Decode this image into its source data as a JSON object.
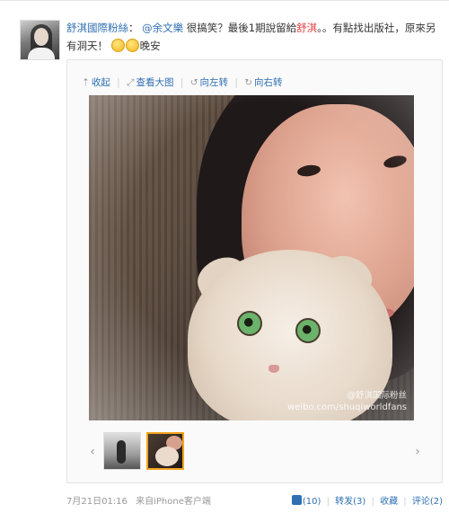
{
  "post": {
    "author": "舒淇國際粉絲",
    "colon": "：",
    "mention": "@余文樂",
    "text_part1": " 很搞笑？最後1期說留給",
    "highlight": "舒淇",
    "text_part2": "。。有點找出版社，原來另有洞天！",
    "text_part3": "晚安"
  },
  "card": {
    "tools": {
      "collect": "收起",
      "view_large": "查看大图",
      "rotate_left": "向左转",
      "rotate_right": "向右转"
    },
    "watermark": {
      "line1": "@舒淇国际粉丝",
      "line2": "weibo.com/shuqiworldfans"
    }
  },
  "footer": {
    "time": "7月21日01:16",
    "source": "来自iPhone客户端",
    "likes": "(10)",
    "repost": "转发(3)",
    "favorite": "收藏",
    "comment": "评论(2)"
  },
  "colors": {
    "link": "#2f6fb2",
    "highlight": "#e03c3c",
    "selected_thumb_border": "#f4a321"
  }
}
